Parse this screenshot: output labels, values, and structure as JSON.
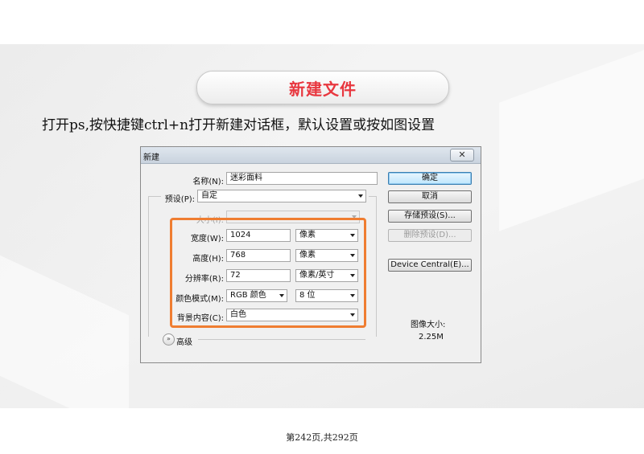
{
  "slide": {
    "title": "新建文件",
    "instruction": "打开ps,按快捷键ctrl+n打开新建对话框，默认设置或按如图设置",
    "footer": "第242页,共292页"
  },
  "dialog": {
    "title": "新建",
    "close_label": "✕",
    "name": {
      "label": "名称(N):",
      "value": "迷彩面料"
    },
    "preset": {
      "label": "预设(P):",
      "value": "自定"
    },
    "size": {
      "label": "大小(I):",
      "value": ""
    },
    "width": {
      "label": "宽度(W):",
      "value": "1024",
      "unit": "像素"
    },
    "height": {
      "label": "高度(H):",
      "value": "768",
      "unit": "像素"
    },
    "resolution": {
      "label": "分辨率(R):",
      "value": "72",
      "unit": "像素/英寸"
    },
    "color_mode": {
      "label": "颜色模式(M):",
      "value": "RGB 颜色",
      "depth": "8 位"
    },
    "background": {
      "label": "背景内容(C):",
      "value": "白色"
    },
    "advanced_label": "高级",
    "buttons": {
      "ok": "确定",
      "cancel": "取消",
      "save_preset": "存储预设(S)...",
      "delete_preset": "删除预设(D)...",
      "device_central": "Device Central(E)..."
    },
    "image_size": {
      "label": "图像大小:",
      "value": "2.25M"
    }
  },
  "colors": {
    "title_red": "#e8373f",
    "highlight_orange": "#ef7d31"
  },
  "icons": [
    "close-icon",
    "chevron-down-icon",
    "expand-advanced-icon"
  ]
}
